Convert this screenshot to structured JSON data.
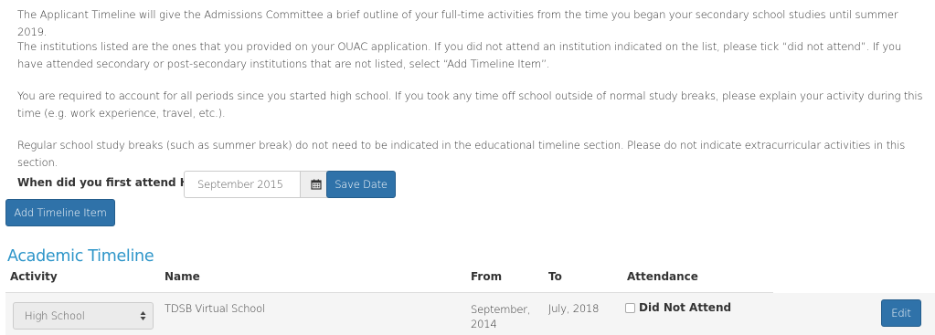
{
  "intro": {
    "p1": "The Applicant Timeline will give the Admissions Committee a brief outline of your full-time activities from the time you began your secondary school studies until summer 2019.",
    "p2": "The institutions listed are the ones that you provided on your OUAC application. If you did not attend an institution indicated on the list, please tick “did not attend”. If you have attended secondary or post-secondary institutions that are not listed, select “Add Timeline Item”.",
    "p3": "You are required to account for all periods since you started high school. If you took any time off school outside of normal study breaks, please explain your activity during this time (e.g. work experience, travel, etc.).",
    "p4": "Regular school study breaks (such as summer break) do not need to be indicated in the educational timeline section. Please do not indicate extracurricular activities in this section."
  },
  "hs_date": {
    "label": "When did you first attend HS:",
    "value": "September 2015",
    "calendar_icon": "calendar-icon",
    "save_label": "Save Date"
  },
  "add_item_label": "Add Timeline Item",
  "timeline": {
    "title": "Academic Timeline",
    "columns": {
      "activity": "Activity",
      "name": "Name",
      "from": "From",
      "to": "To",
      "attendance": "Attendance"
    },
    "rows": [
      {
        "activity": "High School",
        "name": "TDSB Virtual School",
        "from": "September, 2014",
        "to": "July, 2018",
        "did_not_attend_label": "Did Not Attend",
        "did_not_attend_checked": false,
        "edit_label": "Edit"
      }
    ]
  },
  "colors": {
    "primary_button": "#2f72a9",
    "section_title": "#2d95c9",
    "row_background": "#f5f5f5"
  }
}
